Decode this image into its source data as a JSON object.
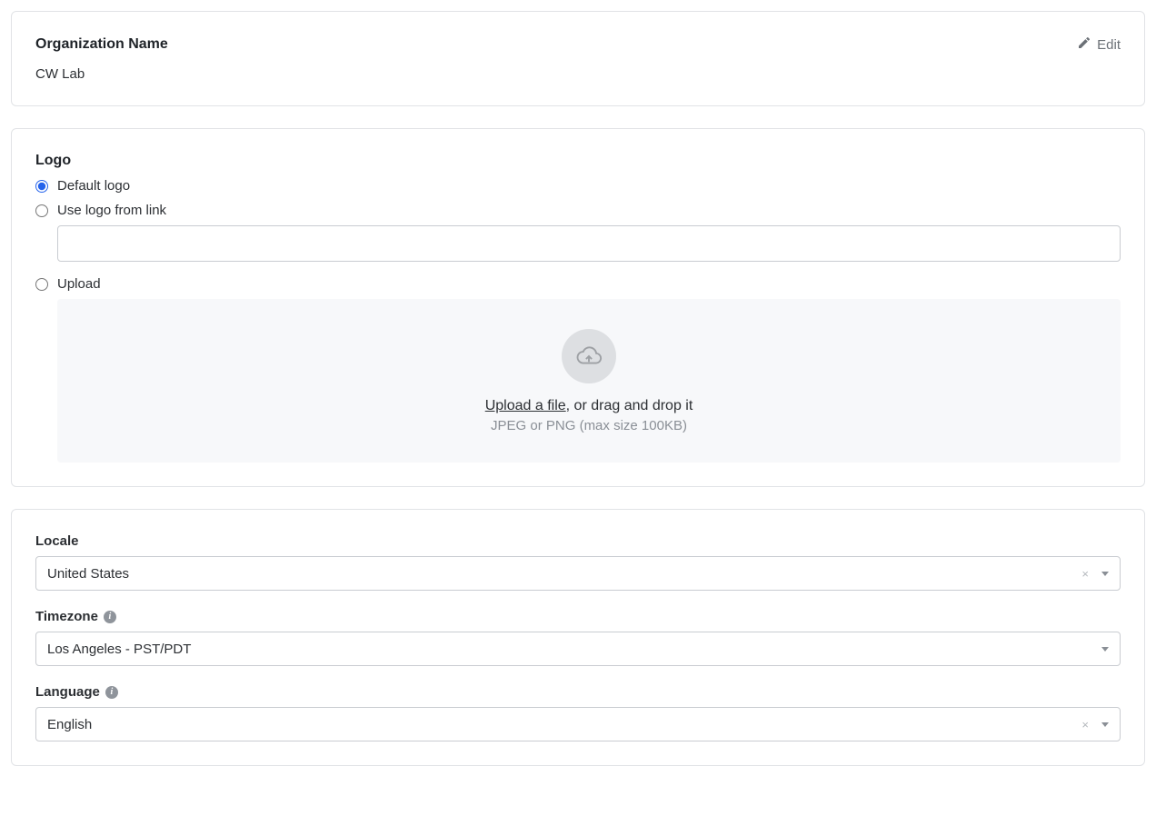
{
  "org": {
    "title": "Organization Name",
    "value": "CW Lab",
    "edit_label": "Edit"
  },
  "logo": {
    "title": "Logo",
    "options": {
      "default": "Default logo",
      "link": "Use logo from link",
      "upload": "Upload"
    },
    "link_value": "",
    "upload_link_text": "Upload a file",
    "upload_rest_text": ", or drag and drop it",
    "upload_hint": "JPEG or PNG (max size 100KB)"
  },
  "locale": {
    "label": "Locale",
    "value": "United States"
  },
  "timezone": {
    "label": "Timezone",
    "value": "Los Angeles - PST/PDT"
  },
  "language": {
    "label": "Language",
    "value": "English"
  }
}
